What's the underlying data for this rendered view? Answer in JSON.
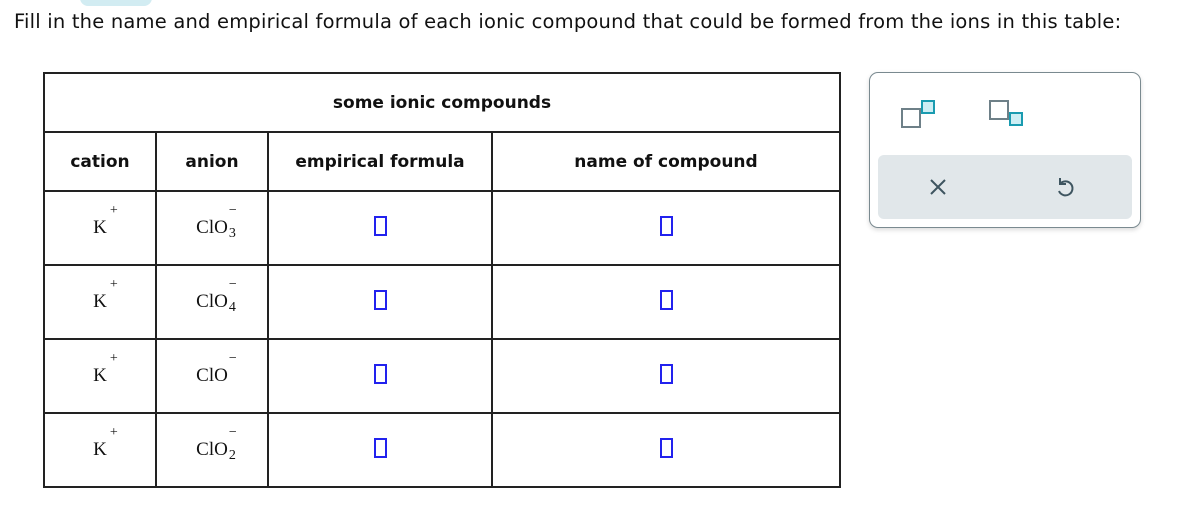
{
  "prompt": "Fill in the name and empirical formula of each ionic compound that could be formed from the ions in this table:",
  "table": {
    "title": "some ionic compounds",
    "headers": [
      "cation",
      "anion",
      "empirical formula",
      "name of compound"
    ],
    "rows": [
      {
        "cation": {
          "base": "K",
          "charge": "+"
        },
        "anion": {
          "base": "ClO",
          "sub": "3",
          "charge": "−"
        },
        "empirical_formula": "",
        "name": ""
      },
      {
        "cation": {
          "base": "K",
          "charge": "+"
        },
        "anion": {
          "base": "ClO",
          "sub": "4",
          "charge": "−"
        },
        "empirical_formula": "",
        "name": ""
      },
      {
        "cation": {
          "base": "K",
          "charge": "+"
        },
        "anion": {
          "base": "ClO",
          "sub": "",
          "charge": "−"
        },
        "empirical_formula": "",
        "name": ""
      },
      {
        "cation": {
          "base": "K",
          "charge": "+"
        },
        "anion": {
          "base": "ClO",
          "sub": "2",
          "charge": "−"
        },
        "empirical_formula": "",
        "name": ""
      }
    ]
  },
  "tool_panel": {
    "icons": [
      "superscript-template-icon",
      "subscript-template-icon"
    ],
    "actions": [
      "clear-icon",
      "undo-icon"
    ]
  },
  "colors": {
    "answer_box": "#2222ee",
    "accent": "#1a9bb0",
    "panel_bg": "#e1e7ea"
  }
}
